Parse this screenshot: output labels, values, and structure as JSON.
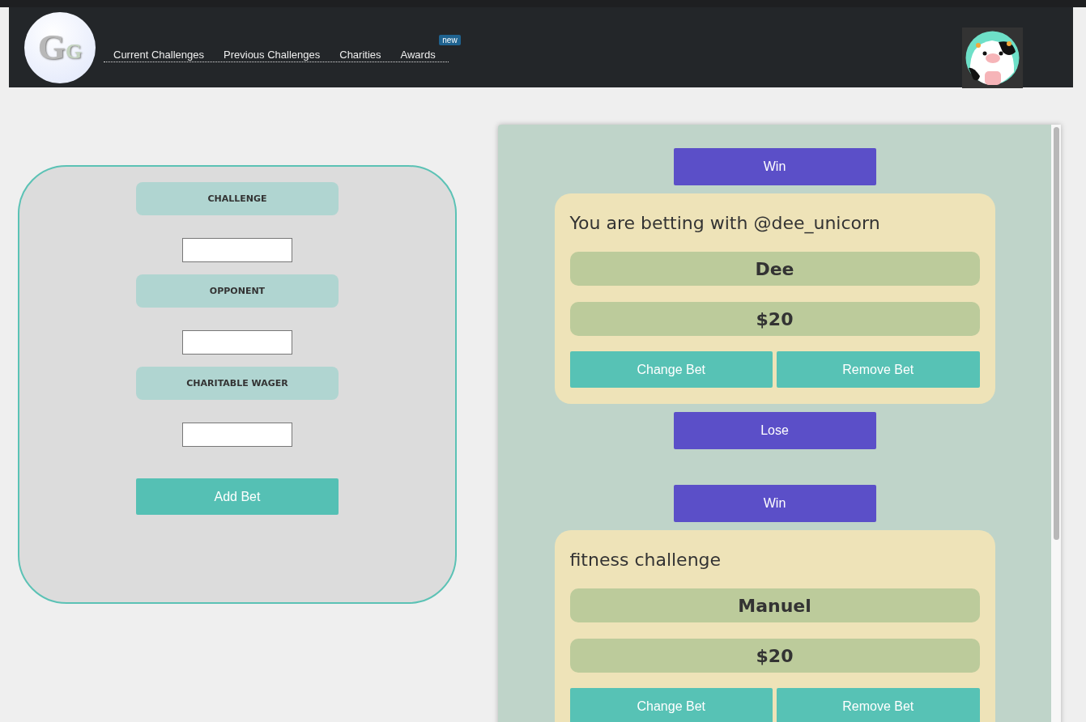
{
  "header": {
    "logo_letters": [
      "G",
      "G"
    ],
    "nav": [
      {
        "label": "Current Challenges"
      },
      {
        "label": "Previous Challenges"
      },
      {
        "label": "Charities"
      },
      {
        "label": "Awards",
        "badge": "new"
      }
    ]
  },
  "bet_form": {
    "fields": [
      {
        "label": "CHALLENGE"
      },
      {
        "label": "OPPONENT"
      },
      {
        "label": "CHARITABLE WAGER"
      }
    ],
    "submit": "Add Bet"
  },
  "bets": [
    {
      "win": "Win",
      "title": "You are betting with @dee_unicorn",
      "opponent": "Dee",
      "amount": "$20",
      "actions": [
        "Change Bet",
        "Remove Bet"
      ],
      "lose": "Lose"
    },
    {
      "win": "Win",
      "title": "fitness challenge",
      "opponent": "Manuel",
      "amount": "$20",
      "actions": [
        "Change Bet",
        "Remove Bet"
      ]
    }
  ]
}
